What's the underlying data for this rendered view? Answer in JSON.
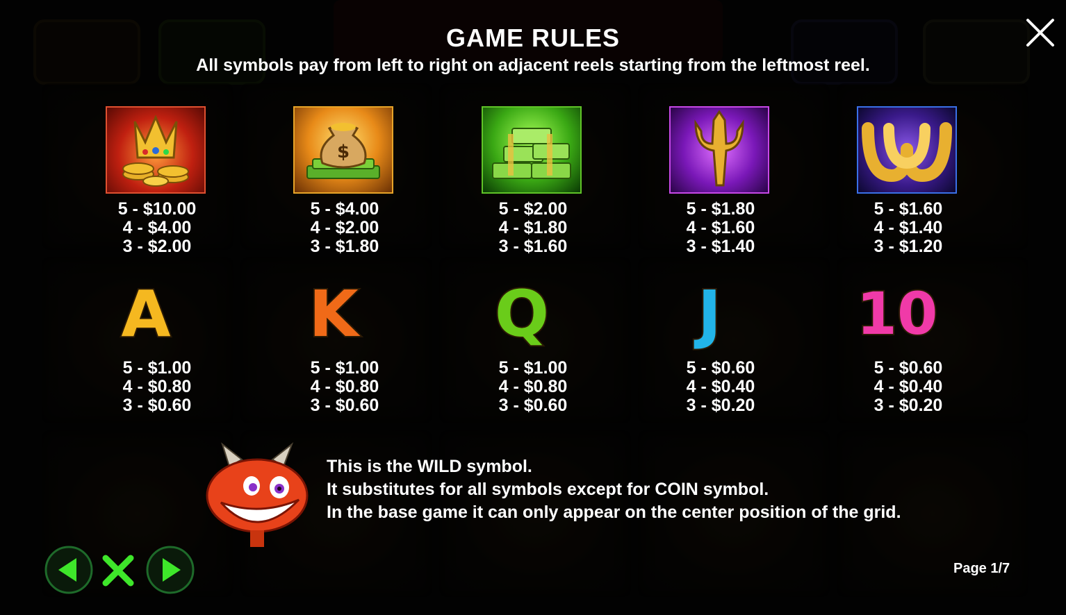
{
  "header": {
    "title": "GAME RULES",
    "subtitle": "All symbols pay from left to right on adjacent reels starting from the leftmost reel."
  },
  "close_icon": "close-icon",
  "high_symbols": [
    {
      "name": "crown-coins",
      "icon": "crown-icon",
      "frame_color": "#d9442a",
      "pays": [
        "5 - $10.00",
        "4 - $4.00",
        "3 - $2.00"
      ]
    },
    {
      "name": "money-bag",
      "icon": "money-bag-icon",
      "frame_color": "#e0a020",
      "pays": [
        "5 - $4.00",
        "4 - $2.00",
        "3 - $1.80"
      ]
    },
    {
      "name": "cash-stacks",
      "icon": "cash-stack-icon",
      "frame_color": "#58c020",
      "pays": [
        "5 - $2.00",
        "4 - $1.80",
        "3 - $1.60"
      ]
    },
    {
      "name": "trident",
      "icon": "trident-icon",
      "frame_color": "#c040e0",
      "pays": [
        "5 - $1.80",
        "4 - $1.60",
        "3 - $1.40"
      ]
    },
    {
      "name": "horseshoe",
      "icon": "horseshoe-icon",
      "frame_color": "#3a6adf",
      "pays": [
        "5 - $1.60",
        "4 - $1.40",
        "3 - $1.20"
      ]
    }
  ],
  "low_symbols": [
    {
      "label": "A",
      "color": "#f5b820",
      "pays": [
        "5 - $1.00",
        "4 - $0.80",
        "3 - $0.60"
      ]
    },
    {
      "label": "K",
      "color": "#f06a18",
      "pays": [
        "5 - $1.00",
        "4 - $0.80",
        "3 - $0.60"
      ]
    },
    {
      "label": "Q",
      "color": "#6acc1a",
      "pays": [
        "5 - $1.00",
        "4 - $0.80",
        "3 - $0.60"
      ]
    },
    {
      "label": "J",
      "color": "#22b4e8",
      "pays": [
        "5 - $0.60",
        "4 - $0.40",
        "3 - $0.20"
      ]
    },
    {
      "label": "10",
      "color": "#f03aa8",
      "pays": [
        "5 - $0.60",
        "4 - $0.40",
        "3 - $0.20"
      ]
    }
  ],
  "wild": {
    "icon": "devil-wild-icon",
    "lines": [
      "This is the WILD symbol.",
      "It substitutes for all symbols except for COIN symbol.",
      "In the base game it can only appear on the center position of the grid."
    ]
  },
  "navigation": {
    "prev_icon": "arrow-left-icon",
    "close_icon": "close-x-icon",
    "next_icon": "arrow-right-icon",
    "accent_color": "#3ee62a"
  },
  "page": {
    "label": "Page 1/7"
  }
}
